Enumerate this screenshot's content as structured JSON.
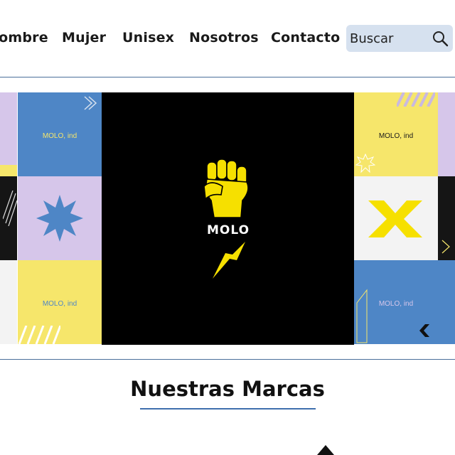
{
  "nav": {
    "links": [
      "Hombre",
      "Mujer",
      "Unisex",
      "Nosotros",
      "Contacto"
    ],
    "search_placeholder": "Buscar"
  },
  "banner": {
    "brand_name": "MOLO",
    "tile_label": "MOLO, ind"
  },
  "section": {
    "title": "Nuestras Marcas"
  },
  "colors": {
    "accent_blue": "#4e86c6",
    "yellow": "#f6e66b",
    "lavender": "#d6c6ea",
    "black": "#000000",
    "search_bg": "#d6e1ef"
  }
}
